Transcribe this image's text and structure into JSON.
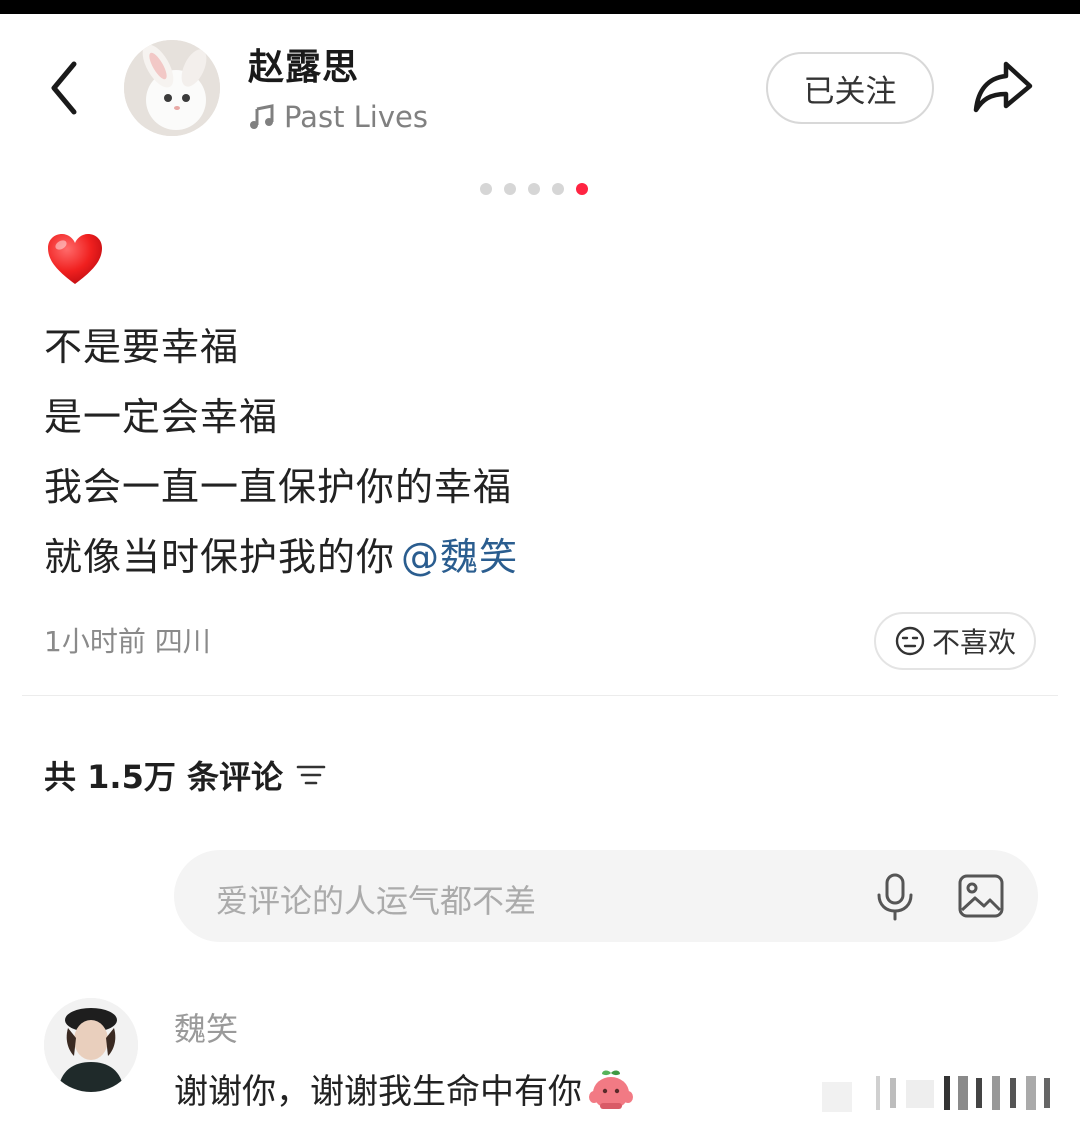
{
  "header": {
    "user_name": "赵露思",
    "music_title": "Past Lives",
    "follow_label": "已关注"
  },
  "pager": {
    "total": 5,
    "active_index": 4,
    "active_color": "#ff2442"
  },
  "post": {
    "lines": [
      "不是要幸福",
      "是一定会幸福",
      "我会一直一直保护你的幸福",
      "就像当时保护我的你"
    ],
    "mention": "@魏笑",
    "time_location": "1小时前 四川",
    "dislike_label": "不喜欢"
  },
  "comments": {
    "count_label": "共 1.5万 条评论",
    "input_placeholder": "爱评论的人运气都不差",
    "items": [
      {
        "user": "魏笑",
        "text": "谢谢你，谢谢我生命中有你"
      }
    ]
  },
  "icons": {
    "back": "chevron-left-icon",
    "music": "music-note-icon",
    "share": "share-arrow-icon",
    "heart": "red-heart-emoji",
    "dislike": "neutral-face-icon",
    "sort": "sort-lines-icon",
    "mic": "microphone-icon",
    "image": "image-icon",
    "comment_emoji": "peach-emoji"
  },
  "colors": {
    "mention": "#2a5d8f",
    "accent": "#ff2442"
  }
}
